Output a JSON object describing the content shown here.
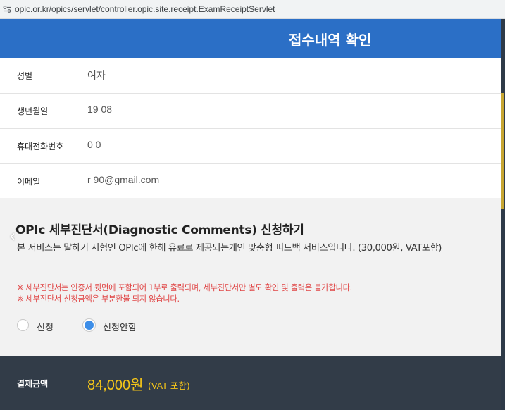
{
  "browser": {
    "url": "opic.or.kr/opics/servlet/controller.opic.site.receipt.ExamReceiptServlet"
  },
  "header": {
    "title": "접수내역 확인"
  },
  "info_rows": [
    {
      "label": "성별",
      "value": "여자"
    },
    {
      "label": "생년월일",
      "value": "19         08"
    },
    {
      "label": "휴대전화번호",
      "value": "0                   0"
    },
    {
      "label": "이메일",
      "value": "r          90@gmail.com"
    }
  ],
  "diagnostic": {
    "title": "OPIc 세부진단서(Diagnostic Comments) 신청하기",
    "description": "본 서비스는 말하기 시험인 OPIc에 한해 유료로 제공되는개인 맞춤형 피드백 서비스입니다. (30,000원, VAT포함)",
    "notices": [
      "※ 세부진단서는 인증서 뒷면에 포함되어 1부로 출력되며, 세부진단서만 별도 확인 및 출력은 불가합니다.",
      "※ 세부진단서 신청금액은 부분환불 되지 않습니다."
    ],
    "options": [
      {
        "label": "신청",
        "selected": false
      },
      {
        "label": "신청안함",
        "selected": true
      }
    ],
    "prev_arrow": "‹"
  },
  "payment": {
    "label": "결제금액",
    "amount": "84,000원",
    "vat_note": "(VAT 포함)"
  },
  "colors": {
    "header": "#2b6fc6",
    "payment_bg": "#323c48",
    "amount": "#f5c518",
    "notice": "#e04545",
    "radio_selected": "#3d8ee8"
  },
  "icons": {
    "url_bar": "site-settings-icon",
    "carousel_prev": "chevron-left-icon"
  }
}
